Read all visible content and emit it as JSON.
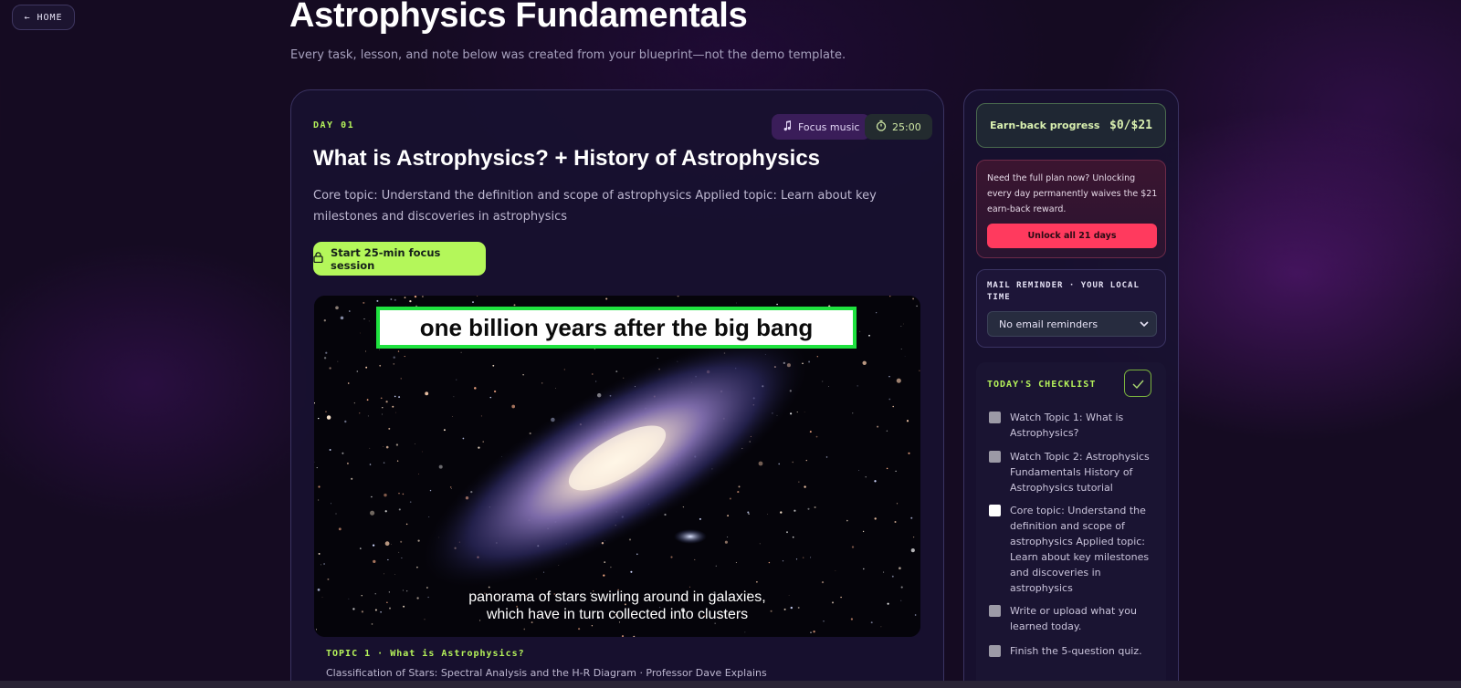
{
  "nav": {
    "home_label": "← HOME"
  },
  "header": {
    "title": "Astrophysics Fundamentals",
    "subtitle": "Every task, lesson, and note below was created from your blueprint—not the demo template."
  },
  "lesson": {
    "day_label": "DAY 01",
    "focus_music_label": "Focus music",
    "timer_label": "25:00",
    "title": "What is Astrophysics? + History of Astrophysics",
    "description": "Core topic: Understand the definition and scope of astrophysics Applied topic: Learn about key milestones and discoveries in astrophysics",
    "focus_button_label": "Start 25-min focus session"
  },
  "video": {
    "overlay_title": "one billion years after the big bang",
    "caption_line1": "panorama of stars swirling around in galaxies,",
    "caption_line2": "which have in turn collected into clusters",
    "topic_label": "TOPIC 1 · What is Astrophysics?",
    "meta": "Classification of Stars: Spectral Analysis and the H-R Diagram · Professor Dave Explains"
  },
  "sidebar": {
    "earn_label": "Earn-back progress",
    "earn_value": "$0/$21",
    "unlock_text": "Need the full plan now? Unlocking every day permanently waives the $21 earn-back reward.",
    "unlock_button_label": "Unlock all 21 days",
    "mail_label": "MAIL REMINDER · YOUR LOCAL TIME",
    "mail_selected": "No email reminders",
    "checklist_title": "TODAY'S CHECKLIST",
    "checklist": [
      {
        "text": "Watch Topic 1: What is Astrophysics?",
        "checked": false
      },
      {
        "text": "Watch Topic 2: Astrophysics Fundamentals History of Astrophysics tutorial",
        "checked": false
      },
      {
        "text": "Core topic: Understand the definition and scope of astrophysics Applied topic: Learn about key milestones and discoveries in astrophysics",
        "checked": false
      },
      {
        "text": "Write or upload what you learned today.",
        "checked": false
      },
      {
        "text": "Finish the 5-question quiz.",
        "checked": false
      }
    ]
  },
  "colors": {
    "accent_green": "#b4f75a",
    "unlock_red": "#ff3a5e",
    "background": "#150b22"
  }
}
